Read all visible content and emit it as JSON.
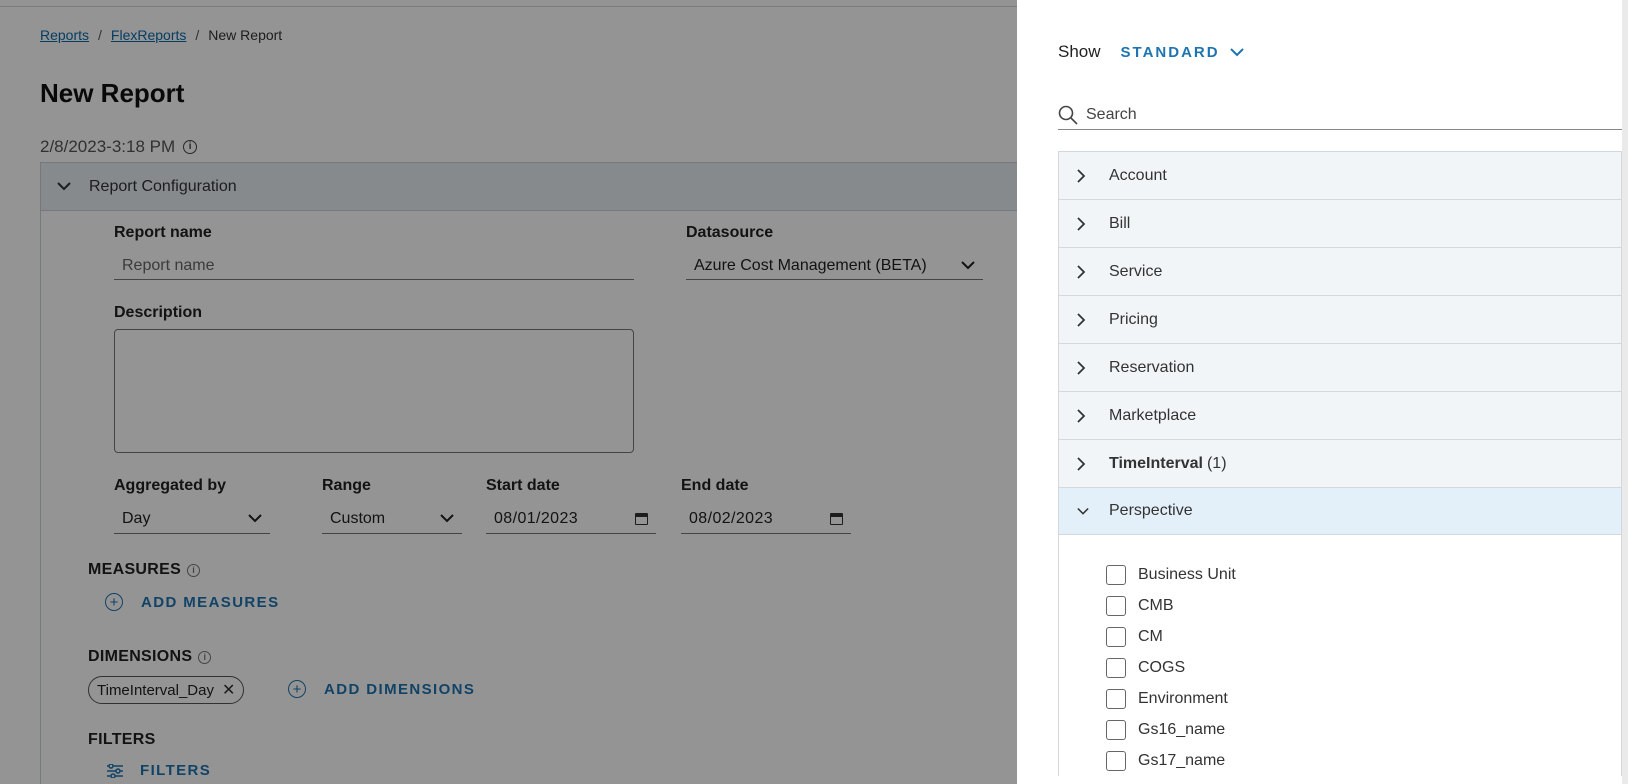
{
  "breadcrumb": {
    "items": [
      {
        "label": "Reports"
      },
      {
        "label": "FlexReports"
      },
      {
        "label": "New Report"
      }
    ],
    "separator": "/"
  },
  "page": {
    "title": "New Report",
    "timestamp": "2/8/2023-3:18 PM"
  },
  "config": {
    "header": "Report Configuration",
    "report_name_label": "Report name",
    "report_name_placeholder": "Report name",
    "datasource_label": "Datasource",
    "datasource_value": "Azure Cost Management (BETA)",
    "description_label": "Description",
    "aggregated_label": "Aggregated by",
    "aggregated_value": "Day",
    "range_label": "Range",
    "range_value": "Custom",
    "start_label": "Start date",
    "start_value": "08/01/2023",
    "end_label": "End date",
    "end_value": "08/02/2023",
    "measures_label": "MEASURES",
    "add_measures": "ADD MEASURES",
    "dimensions_label": "DIMENSIONS",
    "dimension_chip": "TimeInterval_Day",
    "add_dimensions": "ADD DIMENSIONS",
    "filters_label": "FILTERS",
    "filters_button": "FILTERS"
  },
  "drawer": {
    "show_label": "Show",
    "show_value": "STANDARD",
    "search_placeholder": "Search",
    "categories": [
      {
        "label": "Account",
        "count": ""
      },
      {
        "label": "Bill",
        "count": ""
      },
      {
        "label": "Service",
        "count": ""
      },
      {
        "label": "Pricing",
        "count": ""
      },
      {
        "label": "Reservation",
        "count": ""
      },
      {
        "label": "Marketplace",
        "count": ""
      },
      {
        "label": "TimeInterval",
        "count": "(1)"
      },
      {
        "label": "Perspective",
        "count": ""
      }
    ],
    "perspective_options": [
      {
        "label": "Business Unit"
      },
      {
        "label": "CMB"
      },
      {
        "label": "CM"
      },
      {
        "label": "COGS"
      },
      {
        "label": "Environment"
      },
      {
        "label": "Gs16_name"
      },
      {
        "label": "Gs17_name"
      }
    ]
  },
  "colors": {
    "accent": "#1e74b0",
    "overlay": "rgba(0,0,0,0.42)",
    "expanded_row": "#e4f0f9"
  }
}
